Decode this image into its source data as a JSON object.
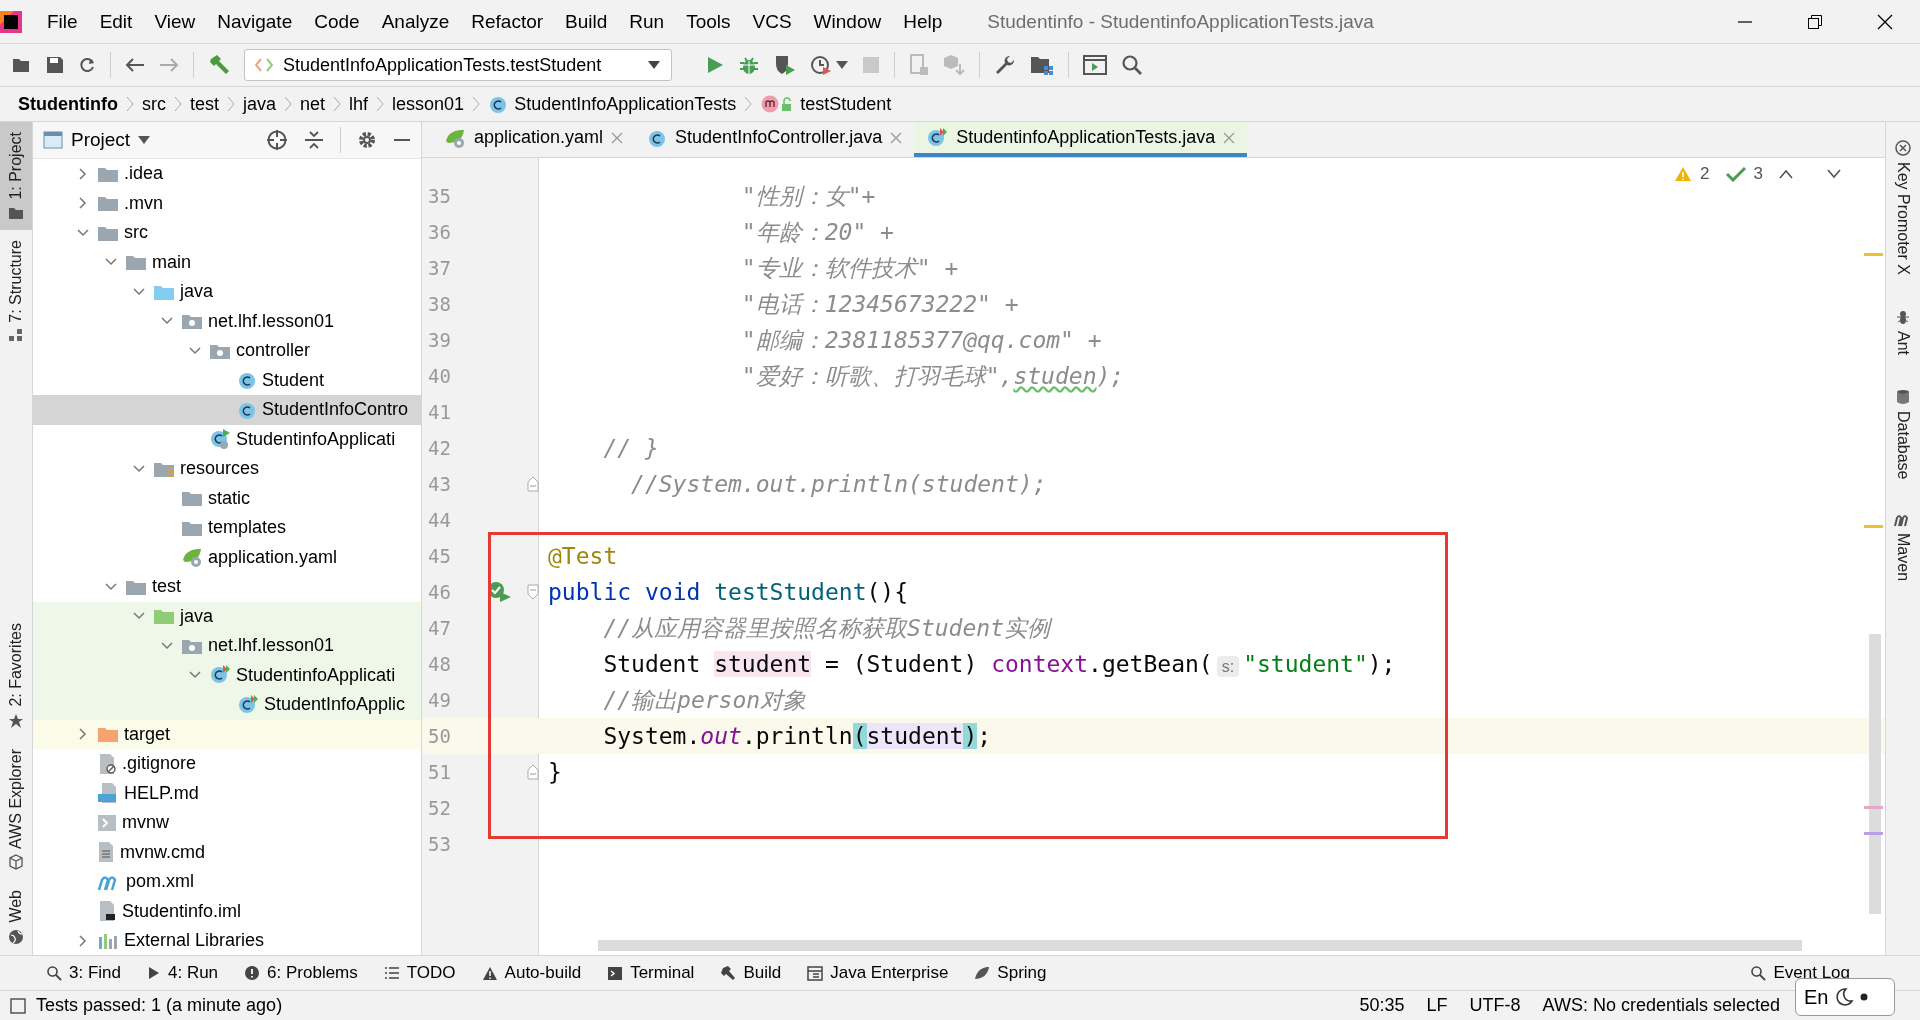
{
  "window": {
    "title": "Studentinfo - StudentinfoApplicationTests.java"
  },
  "menu": [
    "File",
    "Edit",
    "View",
    "Navigate",
    "Code",
    "Analyze",
    "Refactor",
    "Build",
    "Run",
    "Tools",
    "VCS",
    "Window",
    "Help"
  ],
  "toolbar": {
    "run_configuration": "StudentInfoApplicationTests.testStudent"
  },
  "breadcrumb": [
    {
      "label": "Studentinfo",
      "kind": "root"
    },
    {
      "label": "src",
      "kind": "dir"
    },
    {
      "label": "test",
      "kind": "dir"
    },
    {
      "label": "java",
      "kind": "dir"
    },
    {
      "label": "net",
      "kind": "dir"
    },
    {
      "label": "lhf",
      "kind": "dir"
    },
    {
      "label": "lesson01",
      "kind": "dir"
    },
    {
      "label": "StudentInfoApplicationTests",
      "kind": "class"
    },
    {
      "label": "testStudent",
      "kind": "method"
    }
  ],
  "left_tool_tabs_top": [
    {
      "label": "1: Project",
      "kind": "project",
      "selected": true
    },
    {
      "label": "7: Structure",
      "kind": "structure",
      "selected": false
    }
  ],
  "left_tool_tabs_bottom": [
    {
      "label": "2: Favorites",
      "kind": "favorites",
      "selected": false
    },
    {
      "label": "AWS Explorer",
      "kind": "aws",
      "selected": false
    },
    {
      "label": "Web",
      "kind": "web",
      "selected": false
    }
  ],
  "project": {
    "title": "Project",
    "tree": [
      {
        "label": ".idea",
        "kind": "folder",
        "expanded": false,
        "selected": false
      },
      {
        "label": ".mvn",
        "kind": "folder",
        "expanded": false,
        "selected": false
      },
      {
        "label": "src",
        "kind": "folder",
        "expanded": true,
        "selected": false,
        "children": [
          {
            "label": "main",
            "kind": "folder",
            "expanded": true,
            "selected": false,
            "children": [
              {
                "label": "java",
                "kind": "folder-source",
                "expanded": true,
                "selected": false,
                "children": [
                  {
                    "label": "net.lhf.lesson01",
                    "kind": "package",
                    "expanded": true,
                    "selected": false,
                    "children": [
                      {
                        "label": "controller",
                        "kind": "package",
                        "expanded": true,
                        "selected": false,
                        "children": [
                          {
                            "label": "Student",
                            "kind": "class",
                            "selected": false
                          },
                          {
                            "label": "StudentInfoContro",
                            "kind": "class",
                            "selected": true
                          }
                        ]
                      },
                      {
                        "label": "StudentinfoApplicati",
                        "kind": "spring-class",
                        "selected": false
                      }
                    ]
                  }
                ]
              },
              {
                "label": "resources",
                "kind": "resources",
                "expanded": true,
                "selected": false,
                "children": [
                  {
                    "label": "static",
                    "kind": "folder",
                    "selected": false
                  },
                  {
                    "label": "templates",
                    "kind": "folder",
                    "selected": false
                  },
                  {
                    "label": "application.yaml",
                    "kind": "yaml",
                    "selected": false
                  }
                ]
              }
            ]
          },
          {
            "label": "test",
            "kind": "folder",
            "expanded": true,
            "selected": false,
            "children": [
              {
                "label": "java",
                "kind": "folder-test",
                "color": "#eff7e8",
                "expanded": true,
                "selected": false,
                "children": [
                  {
                    "label": "net.lhf.lesson01",
                    "kind": "package",
                    "expanded": true,
                    "selected": false,
                    "children": [
                      {
                        "label": "StudentinfoApplicati",
                        "kind": "test-class",
                        "expanded": true,
                        "selected": false,
                        "children": [
                          {
                            "label": "StudentInfoApplic",
                            "kind": "test-class",
                            "selected": false
                          }
                        ]
                      }
                    ]
                  }
                ]
              }
            ]
          }
        ]
      },
      {
        "label": "target",
        "kind": "folder-excluded",
        "color": "#fbfbe9",
        "expanded": false,
        "selected": false
      },
      {
        "label": ".gitignore",
        "kind": "gitignore",
        "selected": false
      },
      {
        "label": "HELP.md",
        "kind": "markdown",
        "selected": false
      },
      {
        "label": "mvnw",
        "kind": "script",
        "selected": false
      },
      {
        "label": "mvnw.cmd",
        "kind": "text",
        "selected": false
      },
      {
        "label": "pom.xml",
        "kind": "pom",
        "selected": false
      },
      {
        "label": "Studentinfo.iml",
        "kind": "iml",
        "selected": false
      },
      {
        "label": "External Libraries",
        "kind": "libraries",
        "expanded": false,
        "selected": false
      }
    ]
  },
  "tabs": [
    {
      "label": "application.yaml",
      "kind": "yaml",
      "selected": false
    },
    {
      "label": "StudentInfoController.java",
      "kind": "class",
      "selected": false
    },
    {
      "label": "StudentinfoApplicationTests.java",
      "kind": "test-class",
      "selected": true
    }
  ],
  "inspections": {
    "warnings": "2",
    "passed": "3"
  },
  "code": [
    {
      "number": "35",
      "kind": "plain",
      "current": false,
      "tokens": [
        {
          "kind": "comment",
          "text": "              \"性别：女\"+"
        }
      ]
    },
    {
      "number": "36",
      "kind": "plain",
      "current": false,
      "tokens": [
        {
          "kind": "comment",
          "text": "              \"年龄：20\" +"
        }
      ]
    },
    {
      "number": "37",
      "kind": "plain",
      "current": false,
      "tokens": [
        {
          "kind": "comment",
          "text": "              \"专业：软件技术\" +"
        }
      ]
    },
    {
      "number": "38",
      "kind": "plain",
      "current": false,
      "tokens": [
        {
          "kind": "comment",
          "text": "              \"电话：12345673222\" +"
        }
      ]
    },
    {
      "number": "39",
      "kind": "plain",
      "current": false,
      "tokens": [
        {
          "kind": "comment",
          "text": "              \"邮编：2381185377@qq.com\" +"
        }
      ]
    },
    {
      "number": "40",
      "kind": "plain",
      "current": false,
      "tokens": [
        {
          "kind": "comment",
          "text": "              \"爱好：听歌、打羽毛球\","
        },
        {
          "kind": "typo",
          "text": "studen"
        },
        {
          "kind": "comment",
          "text": ");"
        }
      ]
    },
    {
      "number": "41",
      "kind": "plain",
      "current": false
    },
    {
      "number": "42",
      "kind": "plain",
      "current": false,
      "tokens": [
        {
          "kind": "comment",
          "text": "    // }"
        }
      ]
    },
    {
      "number": "43",
      "kind": "fold-end",
      "current": false,
      "tokens": [
        {
          "kind": "comment",
          "text": "      //System.out.println(student);"
        }
      ]
    },
    {
      "number": "44",
      "kind": "plain",
      "current": false
    },
    {
      "number": "45",
      "kind": "plain",
      "current": false,
      "tokens": [
        {
          "kind": "annotation",
          "text": "@Test"
        }
      ]
    },
    {
      "number": "46",
      "kind": "test-start",
      "current": false,
      "tokens": [
        {
          "kind": "keyword",
          "text": "public "
        },
        {
          "kind": "keyword",
          "text": "void "
        },
        {
          "kind": "method",
          "text": "testStudent"
        },
        {
          "kind": "plain",
          "text": "(){"
        }
      ]
    },
    {
      "number": "47",
      "kind": "plain",
      "current": false,
      "tokens": [
        {
          "kind": "comment",
          "text": "    //从应用容器里按照名称获取Student实例"
        }
      ]
    },
    {
      "number": "48",
      "kind": "plain",
      "current": false,
      "tokens": [
        {
          "kind": "plain",
          "text": "    Student "
        },
        {
          "kind": "declaration-mark",
          "text": "student"
        },
        {
          "kind": "plain",
          "text": " = (Student) "
        },
        {
          "kind": "field",
          "text": "context"
        },
        {
          "kind": "plain",
          "text": ".getBean("
        },
        {
          "kind": "hint",
          "text": "s:"
        },
        {
          "kind": "string",
          "text": "\"student\""
        },
        {
          "kind": "plain",
          "text": ");"
        }
      ]
    },
    {
      "number": "49",
      "kind": "plain",
      "current": false,
      "tokens": [
        {
          "kind": "comment",
          "text": "    //输出person对象"
        }
      ]
    },
    {
      "number": "50",
      "kind": "plain",
      "current": true,
      "tokens": [
        {
          "kind": "plain",
          "text": "    System."
        },
        {
          "kind": "static",
          "text": "out"
        },
        {
          "kind": "plain",
          "text": ".println"
        },
        {
          "kind": "brace-match",
          "text": "("
        },
        {
          "kind": "usage-mark",
          "text": "student"
        },
        {
          "kind": "brace-match",
          "text": ")"
        },
        {
          "kind": "plain",
          "text": ";"
        }
      ]
    },
    {
      "number": "51",
      "kind": "fold-end",
      "current": false,
      "tokens": [
        {
          "kind": "plain",
          "text": "}"
        }
      ]
    },
    {
      "number": "52",
      "kind": "plain",
      "current": false
    },
    {
      "number": "53",
      "kind": "plain",
      "current": false
    }
  ],
  "right_tool_tabs": [
    {
      "label": "Key Promoter X",
      "kind": "promoter"
    },
    {
      "label": "Ant",
      "kind": "ant"
    },
    {
      "label": "Database",
      "kind": "database"
    },
    {
      "label": "Maven",
      "kind": "maven"
    }
  ],
  "tool_buttons": [
    {
      "label": "3: Find",
      "kind": "find"
    },
    {
      "label": "4: Run",
      "kind": "run"
    },
    {
      "label": "6: Problems",
      "kind": "problems"
    },
    {
      "label": "TODO",
      "kind": "todo"
    },
    {
      "label": "Auto-build",
      "kind": "warning"
    },
    {
      "label": "Terminal",
      "kind": "terminal"
    },
    {
      "label": "Build",
      "kind": "build"
    },
    {
      "label": "Java Enterprise",
      "kind": "enterprise"
    },
    {
      "label": "Spring",
      "kind": "spring"
    }
  ],
  "event_log": "Event Log",
  "status": {
    "message": "Tests passed: 1 (a minute ago)",
    "position": "50:35",
    "line_separator": "LF",
    "encoding": "UTF-8",
    "aws": "AWS: No credentials selected"
  },
  "ime": {
    "label": "En"
  }
}
